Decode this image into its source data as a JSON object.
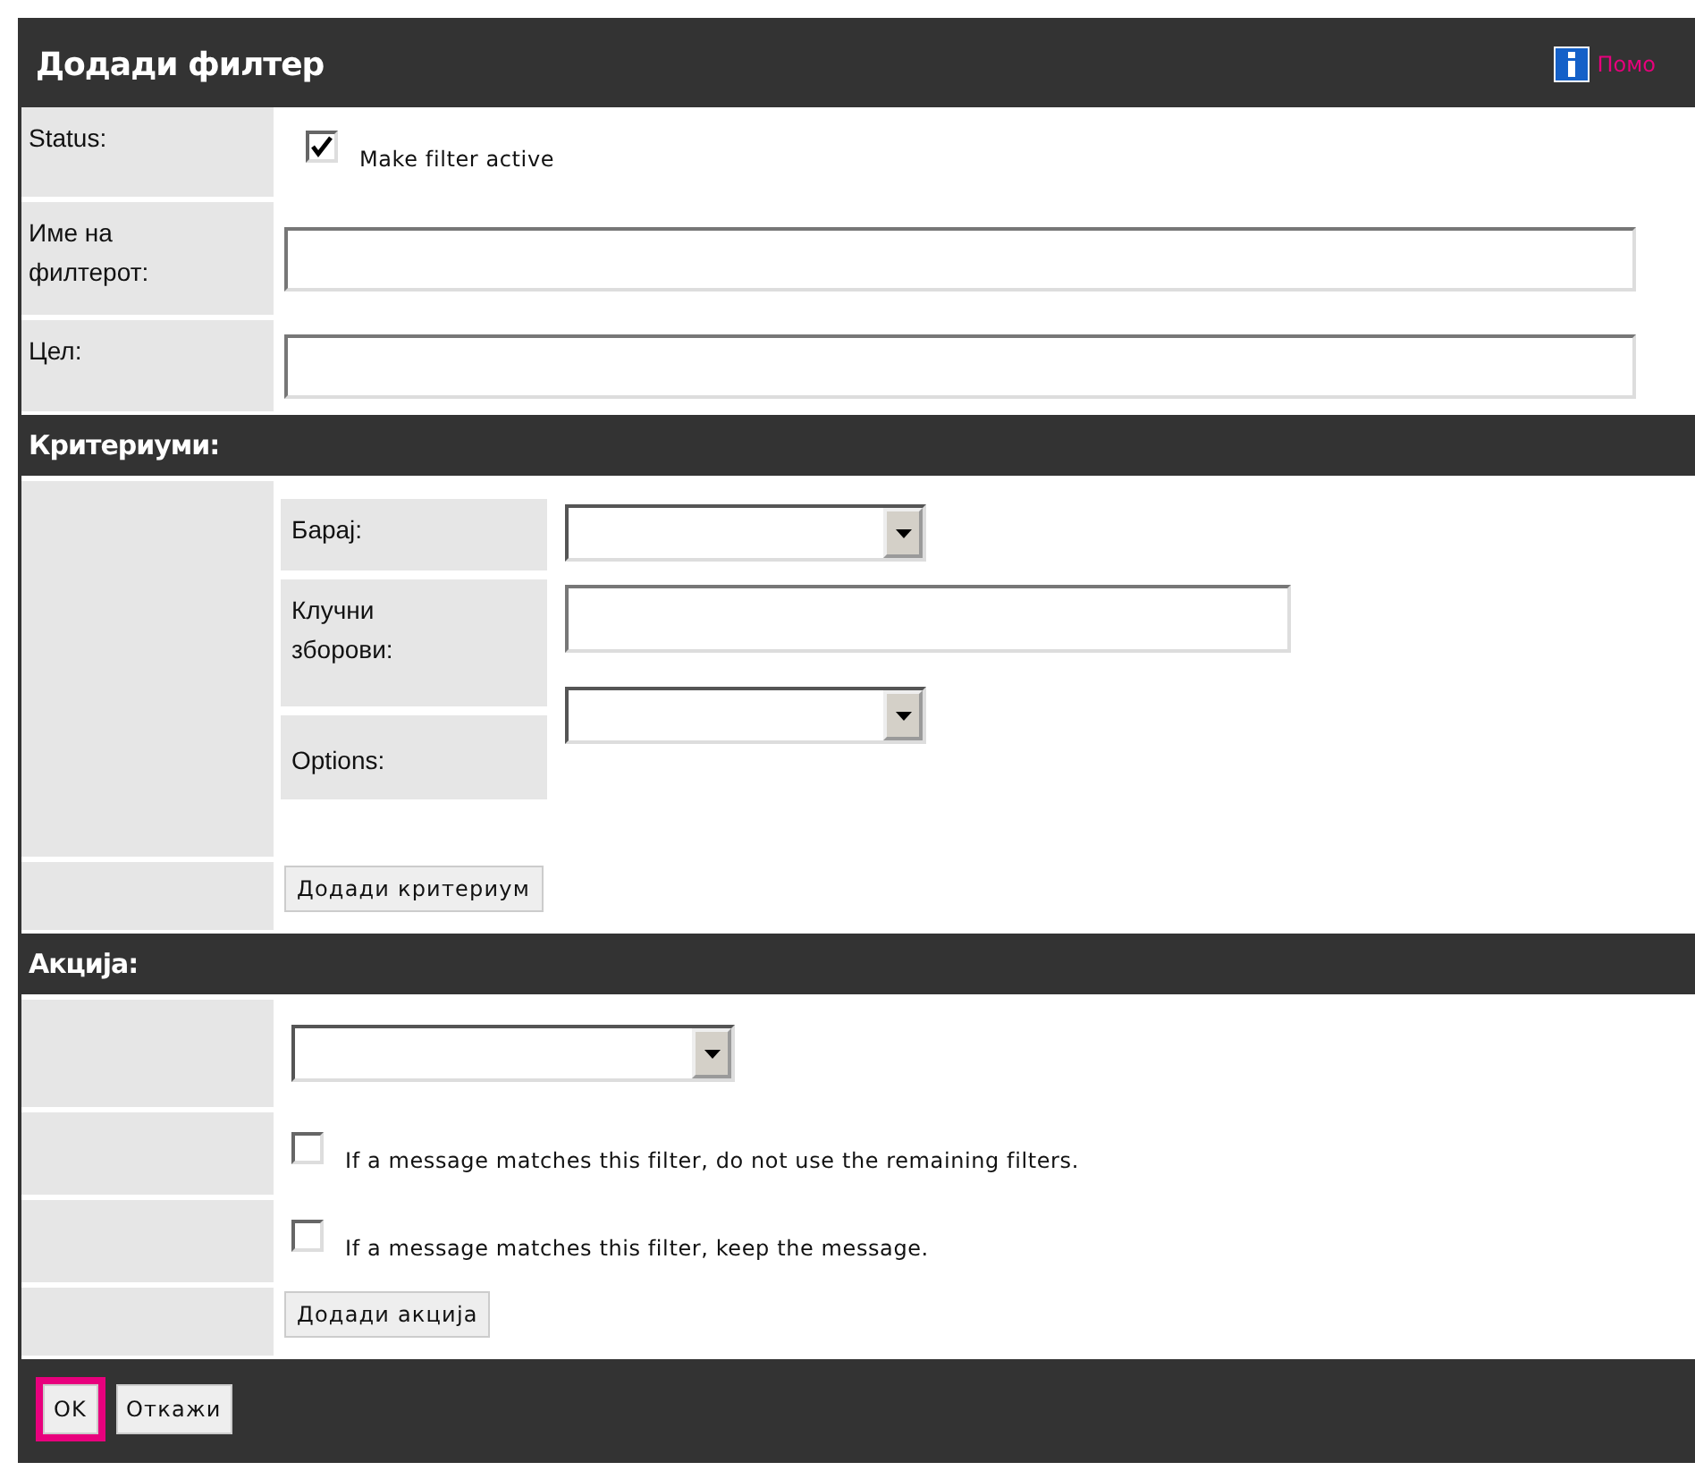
{
  "dialog": {
    "title": "Додади филтер",
    "help_link": "Помо"
  },
  "fields": [
    {
      "kind": "checkbox",
      "label": "Status:",
      "checked": true,
      "text": "Make filter active"
    },
    {
      "kind": "text",
      "label": "Име на филтерот:"
    },
    {
      "kind": "text",
      "label": "Цел:"
    }
  ],
  "criteria": {
    "title": "Критериуми:",
    "rows": [
      {
        "kind": "select",
        "label": "Барај:"
      },
      {
        "kind": "text",
        "label": "Клучни зборови:"
      },
      {
        "kind": "select",
        "label": "Options:"
      }
    ],
    "add_button": "Додади критериум"
  },
  "actions": {
    "title": "Акција:",
    "rows": [
      {
        "kind": "select"
      },
      {
        "kind": "checkbox",
        "checked": false,
        "text": "If a message matches this filter, do not use the remaining filters."
      },
      {
        "kind": "checkbox",
        "checked": false,
        "text": "If a message matches this filter, keep the message."
      }
    ],
    "add_button": "Додади акција"
  },
  "footer": {
    "buttons": [
      {
        "label": "OK",
        "selected": true
      },
      {
        "label": "Откажи",
        "selected": false
      }
    ]
  }
}
